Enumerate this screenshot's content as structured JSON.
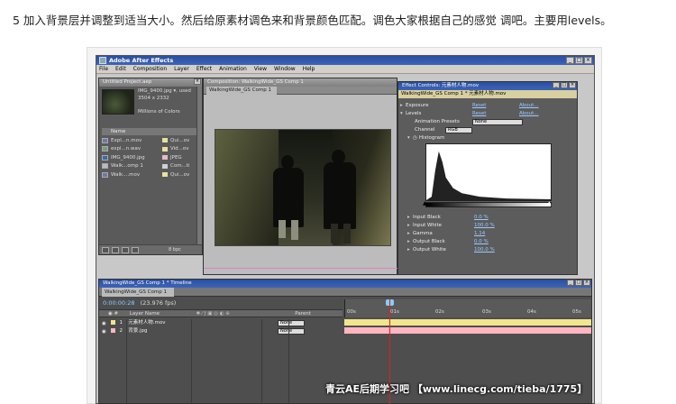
{
  "caption": "5 加入背景层并调整到适当大小。然后给原素材调色来和背景颜色匹配。调色大家根据自己的感觉 调吧。主要用levels。",
  "app": {
    "title": "Adobe After Effects",
    "menu": [
      "File",
      "Edit",
      "Composition",
      "Layer",
      "Effect",
      "Animation",
      "View",
      "Window",
      "Help"
    ],
    "win_controls": [
      "_",
      "□",
      "×"
    ]
  },
  "project": {
    "title": "Untitled Project.aep",
    "info": [
      "IMG_9400.jpg ▾, used",
      "3504 x 2332",
      "",
      "Millions of Colors"
    ],
    "col_name": "Name",
    "items": [
      {
        "name": "Expl...n.mov",
        "type": "Qui...ov"
      },
      {
        "name": "expl...n.wav",
        "type": "Vid...ov"
      },
      {
        "name": "IMG_9400.jpg",
        "type": "JPEG"
      },
      {
        "name": "Walk...omp 1",
        "type": "Com...ti"
      },
      {
        "name": "Walk....mov",
        "type": "Qui...ov"
      }
    ],
    "bpc": "8 bpc"
  },
  "comp": {
    "title": "Composition: WalkingWide_GS Comp 1",
    "tab": "WalkingWide_GS Comp 1"
  },
  "fx": {
    "title": "Effect Controls: 元素材人物.mov",
    "subtitle": "WalkingWide_GS Comp 1 * 元素材人物.mov",
    "rows": [
      {
        "label": "Exposure",
        "reset": "Reset",
        "about": "About..."
      },
      {
        "label": "Levels",
        "reset": "Reset",
        "about": "About..."
      }
    ],
    "presets_label": "Animation Presets",
    "presets_value": "None",
    "channel_label": "Channel",
    "channel_value": "RGB",
    "histogram_label": "Histogram",
    "params": [
      {
        "label": "Input Black",
        "value": "0.0 %"
      },
      {
        "label": "Input White",
        "value": "100.0 %"
      },
      {
        "label": "Gamma",
        "value": "1.14"
      },
      {
        "label": "Output Black",
        "value": "0.0 %"
      },
      {
        "label": "Output White",
        "value": "100.0 %"
      }
    ]
  },
  "timeline": {
    "title": "WalkingWide_GS Comp 1 * Timeline",
    "tab": "WalkingWide_GS Comp 1",
    "timecode": "0:00:00:28",
    "fps": "(23.976 fps)",
    "col_layer": "Layer Name",
    "col_parent": "Parent",
    "layers": [
      {
        "num": "1",
        "name": "元素材人物.mov",
        "parent": "None",
        "color": "#f0e68c"
      },
      {
        "num": "2",
        "name": "背景.jpg",
        "parent": "None",
        "color": "#ffb6c1"
      }
    ],
    "ticks": [
      "00s",
      "01s",
      "02s",
      "03s",
      "04s",
      "05s"
    ]
  },
  "watermark": "青云AE后期学习吧 【www.linecg.com/tieba/1775】"
}
